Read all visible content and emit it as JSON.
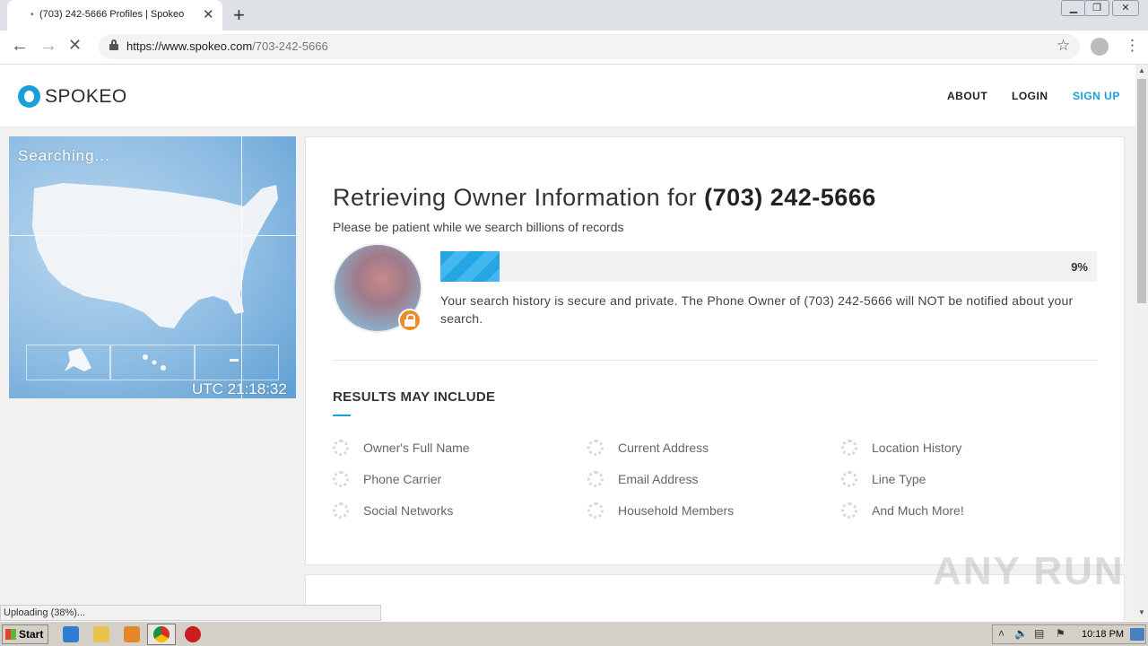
{
  "browser": {
    "tab_title": "(703) 242-5666 Profiles | Spokeo",
    "tab_close": "✕",
    "new_tab": "+",
    "url_domain": "https://www.spokeo.com",
    "url_path": "/703-242-5666"
  },
  "site": {
    "logo": "SPOKEO",
    "nav": {
      "about": "ABOUT",
      "login": "LOGIN",
      "signup": "SIGN UP"
    },
    "accent_color": "#1aa0d8"
  },
  "map": {
    "searching": "Searching...",
    "utc": "UTC 21:18:32"
  },
  "main": {
    "heading_prefix": "Retrieving Owner Information for ",
    "heading_phone": "(703) 242-5666",
    "subtitle": "Please be patient while we search billions of records",
    "progress_percent": 9,
    "progress_label": "9%",
    "privacy_text": "Your search history is secure and private. The Phone Owner of (703) 242-5666 will NOT be notified about your search.",
    "results_title": "RESULTS MAY INCLUDE",
    "results": [
      "Owner's Full Name",
      "Current Address",
      "Location History",
      "Phone Carrier",
      "Email Address",
      "Line Type",
      "Social Networks",
      "Household Members",
      "And Much More!"
    ]
  },
  "status": {
    "upload": "Uploading (38%)..."
  },
  "watermark": "ANY RUN",
  "taskbar": {
    "start": "Start",
    "clock": "10:18 PM"
  }
}
